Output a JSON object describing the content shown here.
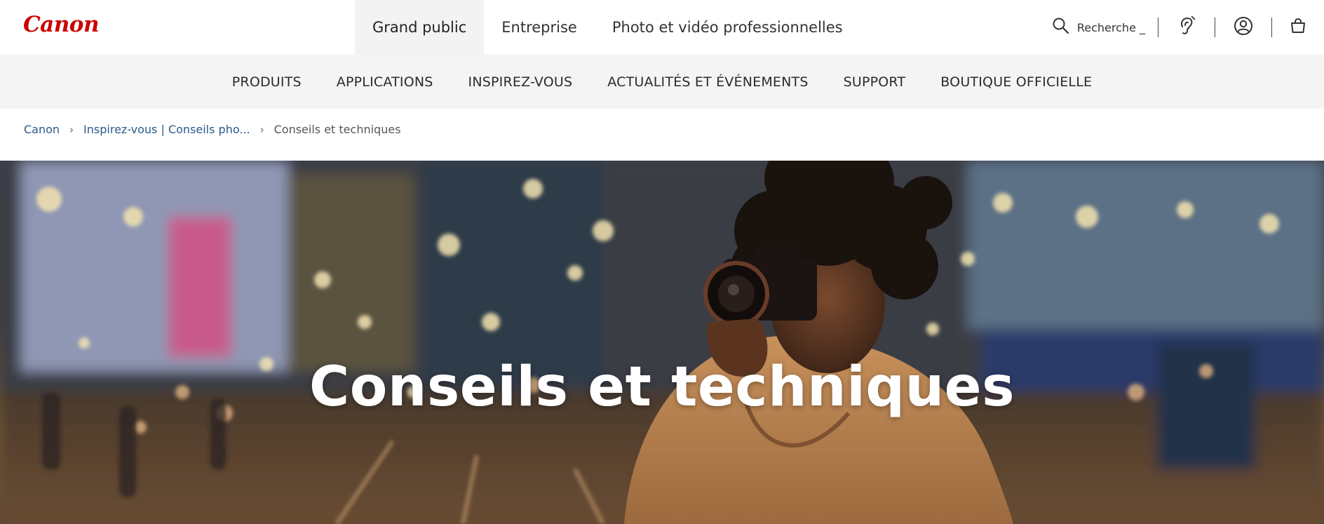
{
  "brand": {
    "logo_text": "Canon",
    "logo_color": "#cc0000"
  },
  "segments": [
    {
      "label": "Grand public",
      "active": true
    },
    {
      "label": "Entreprise",
      "active": false
    },
    {
      "label": "Photo et vidéo professionnelles",
      "active": false
    }
  ],
  "utility": {
    "search_label": "Recherche _",
    "icons": [
      "search-icon",
      "accessibility-icon",
      "account-icon",
      "cart-icon"
    ]
  },
  "main_nav": [
    "PRODUITS",
    "APPLICATIONS",
    "INSPIREZ-VOUS",
    "ACTUALITÉS ET ÉVÉNEMENTS",
    "SUPPORT",
    "BOUTIQUE OFFICIELLE"
  ],
  "breadcrumb": {
    "items": [
      "Canon",
      "Inspirez-vous | Conseils pho..."
    ],
    "current": "Conseils et techniques"
  },
  "hero": {
    "title": "Conseils et techniques"
  },
  "colors": {
    "link": "#2a5a8a",
    "nav_bg": "#f4f4f4",
    "active_segment_bg": "#f3f3f3"
  }
}
